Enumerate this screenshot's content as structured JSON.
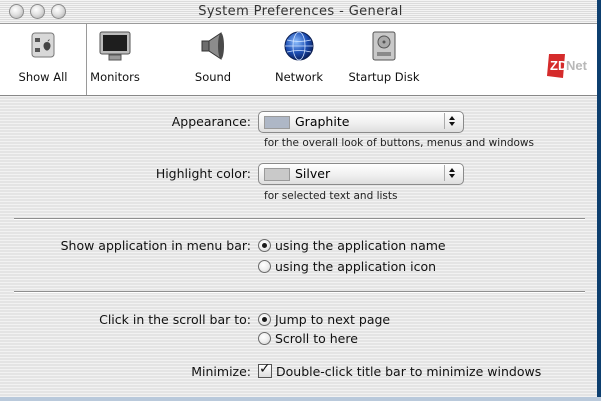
{
  "window": {
    "title": "System Preferences - General"
  },
  "toolbar": {
    "items": [
      {
        "label": "Show All",
        "icon": "apple-switch-icon"
      },
      {
        "label": "Monitors",
        "icon": "monitor-icon"
      },
      {
        "label": "Sound",
        "icon": "speaker-icon"
      },
      {
        "label": "Network",
        "icon": "globe-icon"
      },
      {
        "label": "Startup Disk",
        "icon": "hard-disk-icon"
      }
    ]
  },
  "watermark": {
    "brand": "ZDNet",
    "color": "#d52b2b"
  },
  "appearance": {
    "label": "Appearance:",
    "value": "Graphite",
    "swatch_color": "#aeb7c6",
    "hint": "for the overall look of buttons, menus and windows"
  },
  "highlight": {
    "label": "Highlight color:",
    "value": "Silver",
    "swatch_color": "#c9c9c9",
    "hint": "for selected text and lists"
  },
  "menubar": {
    "label": "Show application in menu bar:",
    "options": [
      {
        "label": "using the application name",
        "selected": true
      },
      {
        "label": "using the application icon",
        "selected": false
      }
    ]
  },
  "scrollbar": {
    "label": "Click in the scroll bar to:",
    "options": [
      {
        "label": "Jump to next page",
        "selected": true
      },
      {
        "label": "Scroll to here",
        "selected": false
      }
    ]
  },
  "minimize": {
    "label": "Minimize:",
    "checkbox_label": "Double-click title bar to minimize windows",
    "checked": true
  }
}
